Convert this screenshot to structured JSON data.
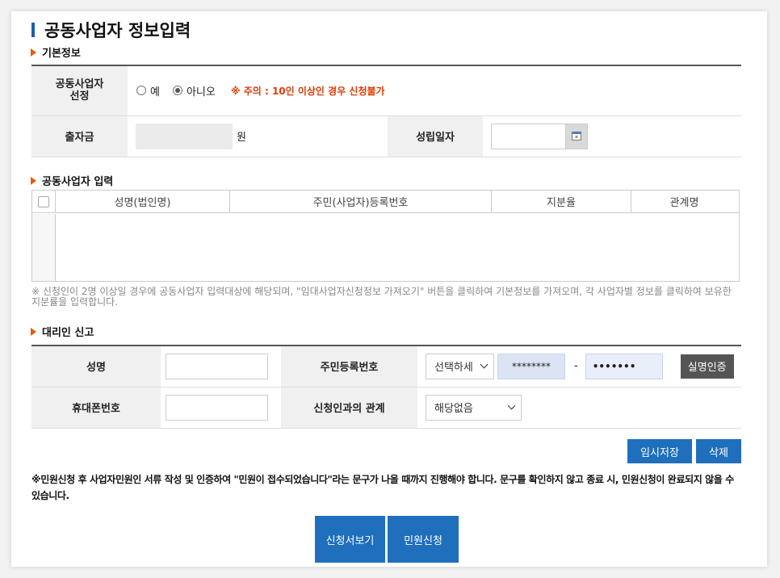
{
  "page": {
    "title": "공동사업자 정보입력"
  },
  "basic_info": {
    "section_title": "기본정보",
    "co_owner_label": "공동사업자 선정",
    "radio_yes": "예",
    "radio_no": "아니오",
    "selected": "아니오",
    "warning": "※ 주의 : 10인 이상인 경우 신청불가",
    "capital_label": "출자금",
    "capital_value": "",
    "capital_unit": "원",
    "established_label": "성립일자",
    "established_value": ""
  },
  "co_owner_input": {
    "section_title": "공동사업자 입력",
    "columns": [
      "성명(법인명)",
      "주민(사업자)등록번호",
      "지분율",
      "관계명"
    ],
    "rows": [],
    "note": "※ 신청인이 2명 이상일 경우에 공동사업자 입력대상에 해당되며, \"임대사업자신청정보 가져오기\" 버튼을 클릭하여 기본정보를 가져오며, 각 사업자별 정보를 클릭하여 보유한 지분률을 입력합니다."
  },
  "agent": {
    "section_title": "대리인 신고",
    "name_label": "성명",
    "name_value": "",
    "rrn_label": "주민등록번호",
    "rrn_select": "선택하세",
    "rrn_front": "********",
    "rrn_dash": "-",
    "rrn_back": "•••••••",
    "verify_button": "실명인증",
    "phone_label": "휴대폰번호",
    "phone_value": "",
    "relation_label": "신청인과의 관계",
    "relation_select": "해당없음"
  },
  "actions": {
    "temp_save": "임시저장",
    "delete": "삭제",
    "notice": "※민원신청 후 사업자민원인 서류 작성 및 인증하여 \"민원이 접수되었습니다\"라는 문구가 나올 때까지 진행해야 합니다. 문구를 확인하지 않고 종료 시, 민원신청이 완료되지 않을 수 있습니다.",
    "view_application": "신청서보기",
    "submit": "민원신청"
  },
  "colors": {
    "accent": "#1f6fbd",
    "warning": "#e03a00",
    "section_marker": "#e8590c",
    "verify_button": "#555555"
  }
}
